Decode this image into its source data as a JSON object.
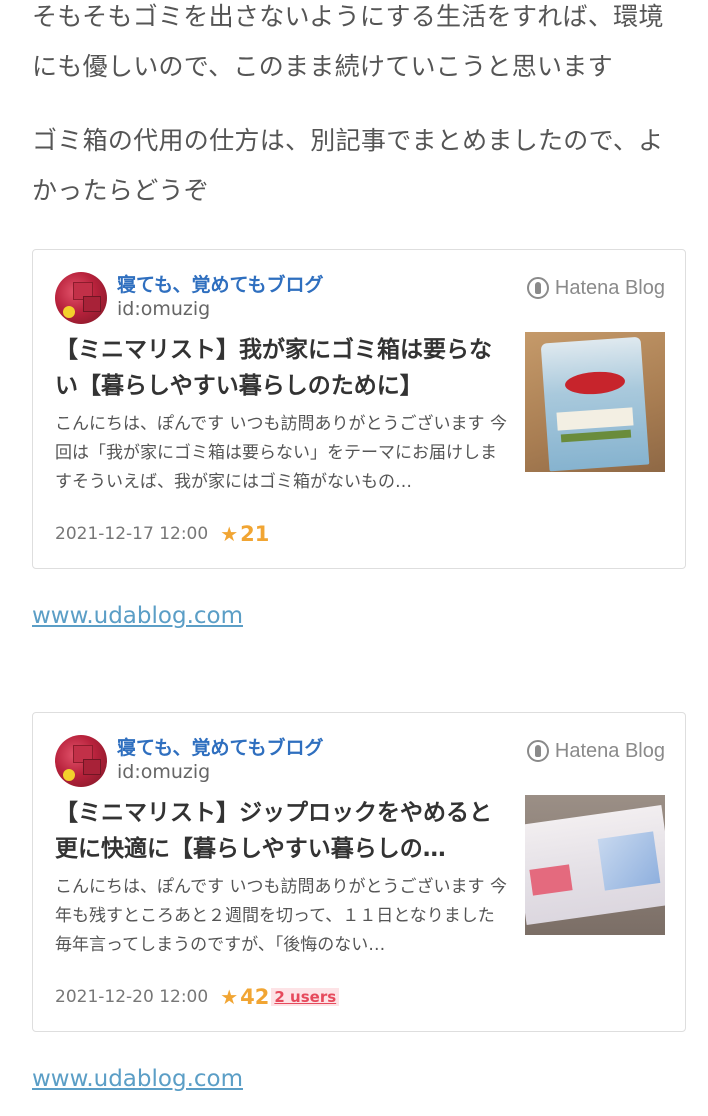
{
  "intro": {
    "paragraph1": "そもそもゴミを出さないようにする生活をすれば、環境にも優しいので、このまま続けていこうと思います",
    "paragraph2": "ゴミ箱の代用の仕方は、別記事でまとめましたので、よかったらどうぞ"
  },
  "cards": [
    {
      "blog_name": "寝ても、覚めてもブログ",
      "blog_id": "id:omuzig",
      "brand": "Hatena Blog",
      "title": "【ミニマリスト】我が家にゴミ箱は要らない【暮らしやすい暮らしのために】",
      "description": "こんにちは、ぽんです いつも訪問ありがとうございます 今回は「我が家にゴミ箱は要らない」をテーマにお届けしますそういえば、我が家にはゴミ箱がないもの…",
      "date": "2021-12-17 12:00",
      "stars": "21",
      "link": "www.udablog.com"
    },
    {
      "blog_name": "寝ても、覚めてもブログ",
      "blog_id": "id:omuzig",
      "brand": "Hatena Blog",
      "title": "【ミニマリスト】ジップロックをやめると更に快適に【暮らしやすい暮らしの…",
      "description": "こんにちは、ぽんです いつも訪問ありがとうございます 今年も残すところあと２週間を切って、１１日となりました 毎年言ってしまうのですが、「後悔のない…",
      "date": "2021-12-20 12:00",
      "stars": "42",
      "users": "2 users",
      "link": "www.udablog.com"
    }
  ],
  "colors": {
    "blog_name": "#2f6fbf",
    "star": "#f1a533",
    "users": "#e64a5c",
    "link": "#5b9ec6"
  }
}
